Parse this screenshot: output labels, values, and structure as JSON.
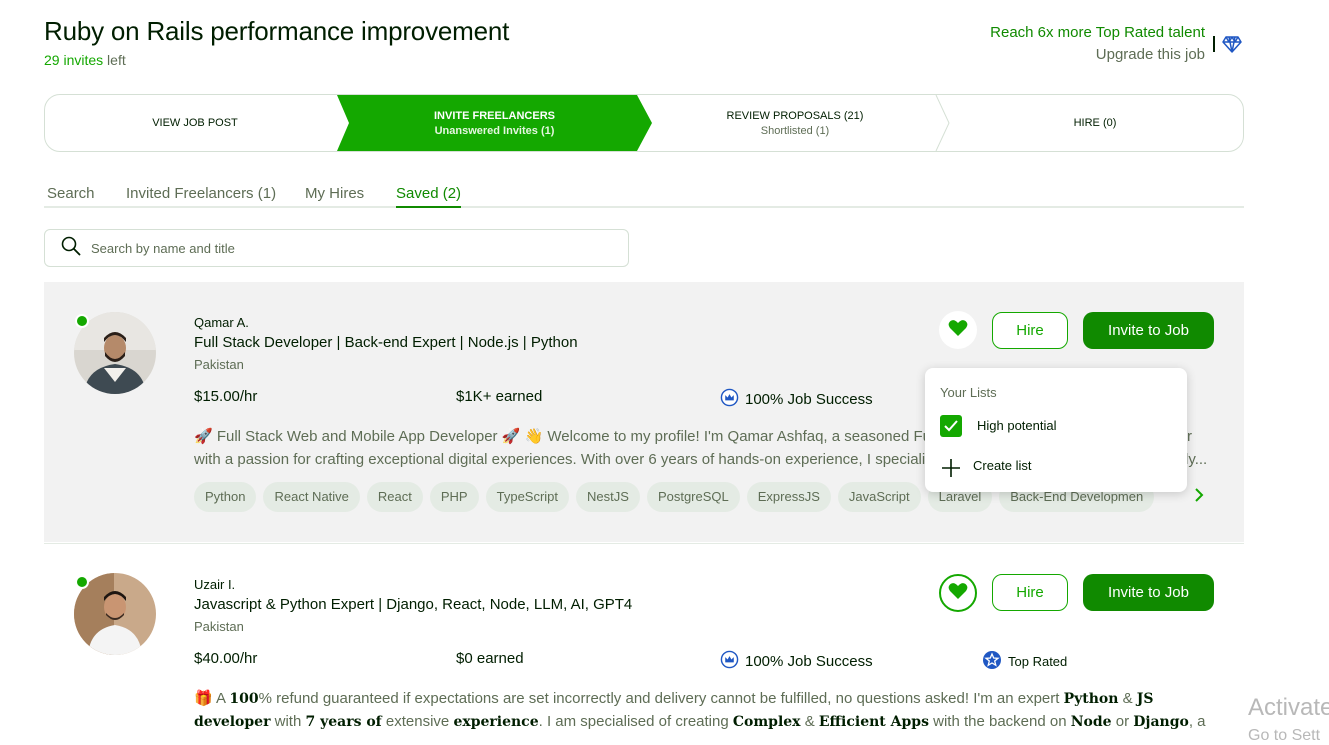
{
  "header": {
    "title": "Ruby on Rails performance improvement",
    "invites_count": "29 invites",
    "invites_suffix": " left",
    "reach_text": "Reach 6x more Top Rated talent",
    "upgrade_text": "Upgrade this job",
    "icon": "diamond-icon"
  },
  "stepper": {
    "steps": [
      {
        "label": "VIEW JOB POST",
        "sub": ""
      },
      {
        "label": "INVITE FREELANCERS",
        "sub": "Unanswered Invites (1)"
      },
      {
        "label": "REVIEW PROPOSALS (21)",
        "sub": "Shortlisted (1)"
      },
      {
        "label": "HIRE (0)",
        "sub": ""
      }
    ],
    "active_index": 1
  },
  "tabs": [
    {
      "label": "Search"
    },
    {
      "label": "Invited Freelancers (1)"
    },
    {
      "label": "My Hires"
    },
    {
      "label": "Saved (2)",
      "active": true
    }
  ],
  "search": {
    "placeholder": "Search by name and title",
    "value": ""
  },
  "freelancers": [
    {
      "name": "Qamar A.",
      "title": "Full Stack Developer | Back-end Expert | Node.js | Python",
      "country": "Pakistan",
      "rate": "$15.00/hr",
      "earned": "$1K+ earned",
      "job_success": "100% Job Success",
      "badge": "",
      "desc_line1": "🚀 Full Stack Web and Mobile App Developer 🚀 👋 Welcome to my profile! I'm Qamar Ashfaq, a seasoned Fu",
      "desc_line1_tail": "r",
      "desc_line2": "with a passion for crafting exceptional digital experiences. With over 6 years of hands-on experience, I speciali",
      "desc_line2_tail": "ly...",
      "skills": [
        "Python",
        "React Native",
        "React",
        "PHP",
        "TypeScript",
        "NestJS",
        "PostgreSQL",
        "ExpressJS",
        "JavaScript",
        "Laravel",
        "Back-End Developmen"
      ],
      "saved": true,
      "online": true
    },
    {
      "name": "Uzair I.",
      "title": "Javascript & Python Expert | Django, React, Node, LLM, AI, GPT4",
      "country": "Pakistan",
      "rate": "$40.00/hr",
      "earned": "$0 earned",
      "job_success": "100% Job Success",
      "badge": "Top Rated",
      "saved": true,
      "online": true
    }
  ],
  "buttons": {
    "hire": "Hire",
    "invite": "Invite to Job"
  },
  "dropdown": {
    "heading": "Your Lists",
    "items": [
      {
        "label": "High potential",
        "checked": true
      },
      {
        "label": "Create list"
      }
    ]
  },
  "watermark": {
    "line1": "Activate",
    "line2": "Go to Sett"
  },
  "colors": {
    "brand_green": "#14a800",
    "dark_green": "#108a00",
    "text": "#001e00",
    "muted": "#5e6d55",
    "badge_blue": "#1f57c3"
  }
}
